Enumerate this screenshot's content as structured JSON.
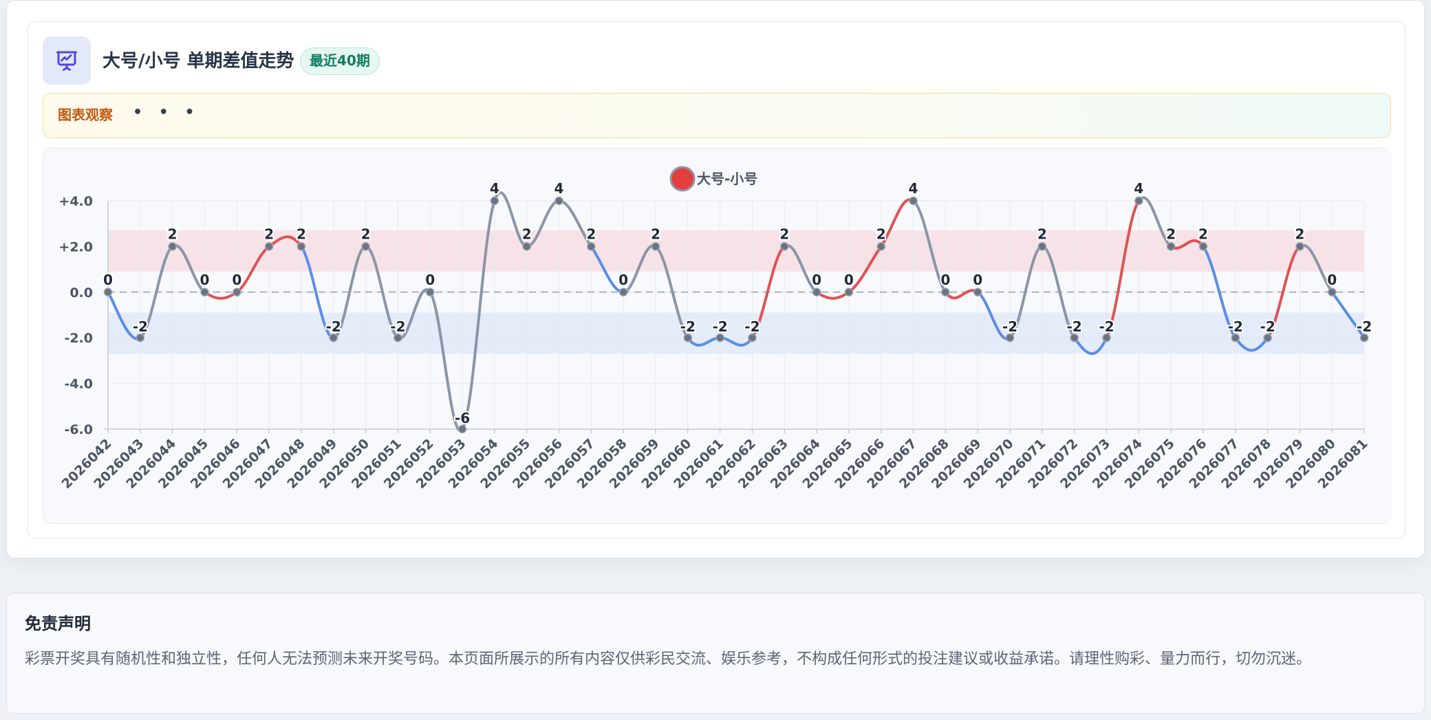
{
  "header": {
    "title": "大号/小号 单期差值走势",
    "badge": "最近40期",
    "icon": "presentation-chart-icon",
    "accent": "#4f46e5"
  },
  "observation": {
    "label": "图表观察",
    "dots": "• • •"
  },
  "chart_data": {
    "type": "line",
    "title": "",
    "xlabel": "",
    "ylabel": "",
    "legend": {
      "label": "大号-小号",
      "placement": "top-center"
    },
    "categories": [
      "2026042",
      "2026043",
      "2026044",
      "2026045",
      "2026046",
      "2026047",
      "2026048",
      "2026049",
      "2026050",
      "2026051",
      "2026052",
      "2026053",
      "2026054",
      "2026055",
      "2026056",
      "2026057",
      "2026058",
      "2026059",
      "2026060",
      "2026061",
      "2026062",
      "2026063",
      "2026064",
      "2026065",
      "2026066",
      "2026067",
      "2026068",
      "2026069",
      "2026070",
      "2026071",
      "2026072",
      "2026073",
      "2026074",
      "2026075",
      "2026076",
      "2026077",
      "2026078",
      "2026079",
      "2026080",
      "2026081"
    ],
    "series": [
      {
        "name": "大号-小号",
        "values": [
          0,
          -2,
          2,
          0,
          0,
          2,
          2,
          -2,
          2,
          -2,
          0,
          -6,
          4,
          2,
          4,
          2,
          0,
          2,
          -2,
          -2,
          -2,
          2,
          0,
          0,
          2,
          4,
          0,
          0,
          -2,
          2,
          -2,
          -2,
          4,
          2,
          2,
          -2,
          -2,
          2,
          0,
          -2
        ]
      }
    ],
    "point_labels": [
      "0",
      "-2",
      "2",
      "0",
      "0",
      "2",
      "2",
      "-2",
      "2",
      "-2",
      "0",
      "-6",
      "4",
      "2",
      "4",
      "2",
      "0",
      "2",
      "-2",
      "-2",
      "-2",
      "2",
      "0",
      "0",
      "2",
      "4",
      "0",
      "0",
      "-2",
      "2",
      "-2",
      "-2",
      "4",
      "2",
      "2",
      "-2",
      "-2",
      "2",
      "0",
      "-2"
    ],
    "ylim": [
      -6,
      4
    ],
    "y_ticks": [
      4,
      2,
      0,
      -2,
      -4,
      -6
    ],
    "y_tick_labels": [
      "+4.0",
      "+2.0",
      "0.0",
      "-2.0",
      "-4.0",
      "-6.0"
    ],
    "bands": [
      {
        "from": 0.9,
        "to": 2.7,
        "color": "#f7e3e7"
      },
      {
        "from": -2.7,
        "to": -0.9,
        "color": "#e4ebf9"
      }
    ],
    "grid": true,
    "colors": {
      "rising": "#e05252",
      "falling": "#5b8de8",
      "reversal": "#8a95a8",
      "point": "#6b7280",
      "legend_swatch": "#e53e3e"
    }
  },
  "disclaimer": {
    "title": "免责声明",
    "text": "彩票开奖具有随机性和独立性，任何人无法预测未来开奖号码。本页面所展示的所有内容仅供彩民交流、娱乐参考，不构成任何形式的投注建议或收益承诺。请理性购彩、量力而行，切勿沉迷。"
  }
}
